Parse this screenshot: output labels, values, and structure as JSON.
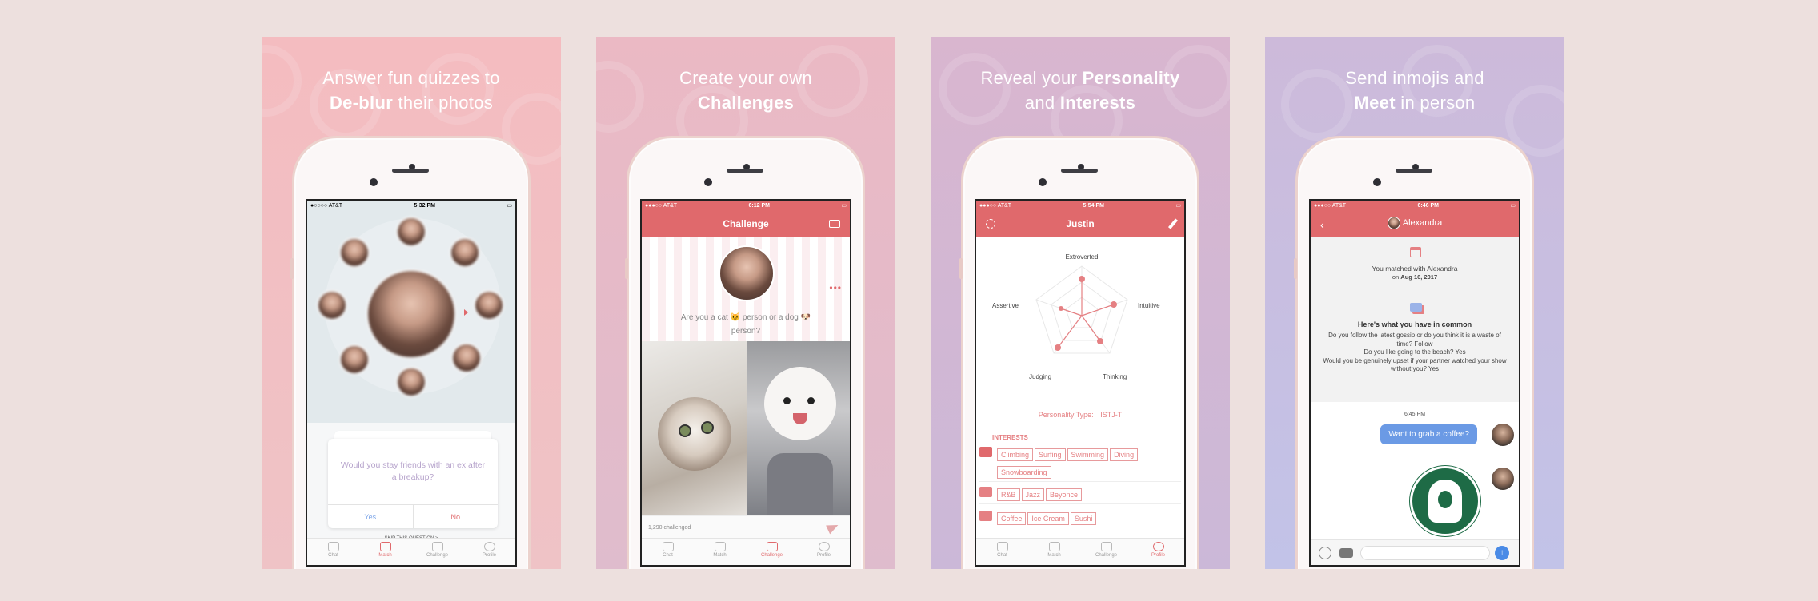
{
  "panels": [
    {
      "caption_line1_pre": "Answer fun quizzes to",
      "caption_line2_bold": "De-blur",
      "caption_line2_rest": " their photos",
      "status": {
        "carrier": "●○○○○ AT&T",
        "time": "5:32 PM"
      },
      "question": "Would you stay friends with an ex after a breakup?",
      "yes": "Yes",
      "no": "No",
      "skip": "SKIP THIS QUESTION >",
      "active_tab": "Match"
    },
    {
      "caption_line1_pre": "Create your own",
      "caption_line2_bold": "Challenges",
      "caption_line2_rest": "",
      "status": {
        "carrier": "●●●○○ AT&T",
        "time": "6:12 PM"
      },
      "nav_title": "Challenge",
      "prompt": "Are you a cat 🐱 person or a dog 🐶 person?",
      "challenged": "1,290 challenged",
      "active_tab": "Challenge"
    },
    {
      "caption_line1_pre": "Reveal your ",
      "caption_line1_bold": "Personality",
      "caption_line2_pre": "and ",
      "caption_line2_bold": "Interests",
      "status": {
        "carrier": "●●●○○ AT&T",
        "time": "5:54 PM"
      },
      "nav_title": "Justin",
      "radar_labels": [
        "Extroverted",
        "Intuitive",
        "Thinking",
        "Judging",
        "Assertive"
      ],
      "personality_label": "Personality Type:",
      "personality_value": "ISTJ-T",
      "interests_header": "INTERESTS",
      "interest_groups": [
        [
          "Climbing",
          "Surfing",
          "Swimming",
          "Diving",
          "Snowboarding"
        ],
        [
          "R&B",
          "Jazz",
          "Beyonce"
        ],
        [
          "Coffee",
          "Ice Cream",
          "Sushi"
        ]
      ],
      "active_tab": "Profile"
    },
    {
      "caption_line1_pre": "Send inmojis and",
      "caption_line2_bold": "Meet",
      "caption_line2_rest": " in person",
      "status": {
        "carrier": "●●●○○ AT&T",
        "time": "6:46 PM"
      },
      "nav_title": "Alexandra",
      "matched_text": "You matched with Alexandra",
      "matched_date_pre": "on",
      "matched_date": "Aug 16, 2017",
      "common_title": "Here's what you have in common",
      "common_body": "Do you follow the latest gossip or do you think it is a waste of time? Follow\nDo you like going to the beach? Yes\nWould you be genuinely upset if your partner watched your show without you? Yes",
      "msg_time": "6:45 PM",
      "message": "Want to grab a coffee?"
    }
  ],
  "tabs": [
    "Chat",
    "Match",
    "Challenge",
    "Profile"
  ],
  "colors": {
    "accent": "#e0696c",
    "blue": "#6b9ae5"
  }
}
